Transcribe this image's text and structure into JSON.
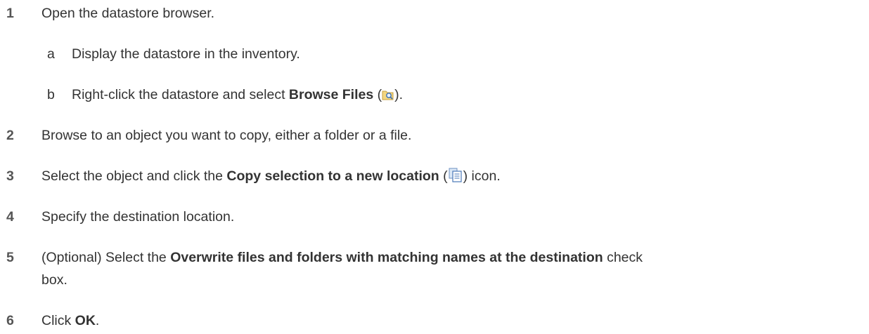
{
  "steps": [
    {
      "number": "1",
      "text": "Open the datastore browser.",
      "substeps": [
        {
          "letter": "a",
          "text": "Display the datastore in the inventory."
        },
        {
          "letter": "b",
          "before": "Right-click the datastore and select ",
          "bold": "Browse Files",
          "icon": "browse-files-icon",
          "after": ")."
        }
      ]
    },
    {
      "number": "2",
      "text": "Browse to an object you want to copy, either a folder or a file."
    },
    {
      "number": "3",
      "before": "Select the object and click the ",
      "bold": "Copy selection to a new location",
      "icon": "copy-icon",
      "after": ") icon."
    },
    {
      "number": "4",
      "text": "Specify the destination location."
    },
    {
      "number": "5",
      "before": "(Optional) Select the ",
      "bold": "Overwrite files and folders with matching names at the destination",
      "after": " check",
      "continuation": "box."
    },
    {
      "number": "6",
      "before": "Click ",
      "bold": "OK",
      "after": "."
    }
  ]
}
